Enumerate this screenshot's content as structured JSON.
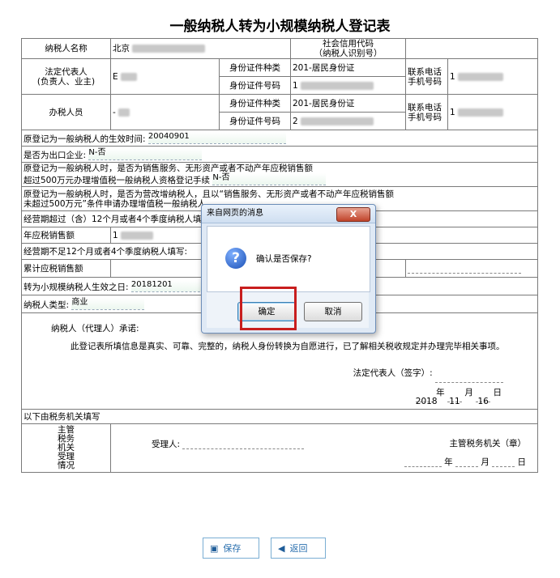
{
  "title": "一般纳税人转为小规模纳税人登记表",
  "form": {
    "taxpayer_name_label": "纳税人名称",
    "taxpayer_name_value": "北京",
    "credit_code_label_1": "社会信用代码",
    "credit_code_label_2": "（纳税人识别号）",
    "legal_rep_label_1": "法定代表人",
    "legal_rep_label_2": "(负责人、业主)",
    "legal_rep_value": "E",
    "id_type_label": "身份证件种类",
    "id_number_label": "身份证件号码",
    "legal_id_type": "201-居民身份证",
    "legal_id_number": "1",
    "phone_label_1": "联系电话",
    "phone_label_2": "手机号码",
    "legal_phone": "1",
    "agent_label": "办税人员",
    "agent_value": "-",
    "agent_id_type": "201-居民身份证",
    "agent_id_number": "2",
    "agent_phone": "1",
    "eff_time_label": "原登记为一般纳税人的生效时间:",
    "eff_time_value": "20040901",
    "export_label": "是否为出口企业:",
    "export_value": "N-否",
    "q3_line1": "原登记为一般纳税人时，是否为销售服务、无形资产或者不动产年应税销售额",
    "q3_line2": "超过500万元办理增值税一般纳税人资格登记手续",
    "q3_value": "N-否",
    "q4_line1": "原登记为一般纳税人时，是否为营改增纳税人，且以“销售服务、无形资产或者不动产年应税销售额",
    "q4_line2": "未超过500万元”条件申请办理增值税一般纳税人",
    "period12_label": "经营期超过（含）12个月或者4个季度纳税人填写",
    "annual_sales_label": "年应税销售额",
    "annual_sales_value": "1",
    "period_short_label": "经营期不足12个月或者4个季度纳税人填写:",
    "cumulative_label": "累计应税销售额",
    "convert_date_label": "转为小规模纳税人生效之日:",
    "convert_date_value": "20181201",
    "type_label": "纳税人类型:",
    "type_value": "商业",
    "promise_title": "纳税人（代理人）承诺:",
    "promise_text": "此登记表所填信息是真实、可靠、完整的，纳税人身份转换为自愿进行，已了解相关税收规定并办理完毕相关事项。",
    "signature_label": "法定代表人（签字）:",
    "sign_year": "2018",
    "sign_month": "11",
    "sign_day": "16",
    "year_char": "年",
    "month_char": "月",
    "day_char": "日",
    "tax_office_fill": "以下由税务机关填写",
    "tax_office_accept": "主管\n税务\n机关\n受理\n情况",
    "receiver_label": "受理人:",
    "office_seal": "主管税务机关（章）"
  },
  "dialog": {
    "title": "来自网页的消息",
    "close_label": "X",
    "message": "确认是否保存?",
    "ok_label": "确定",
    "cancel_label": "取消"
  },
  "buttons": {
    "save_label": "保存",
    "back_label": "返回"
  },
  "colors": {
    "highlight": "#c81e1e",
    "button_text": "#2a6fae"
  },
  "icons": {
    "dialog": "question-icon",
    "save": "floppy-disk-icon",
    "back": "back-arrow-icon"
  }
}
